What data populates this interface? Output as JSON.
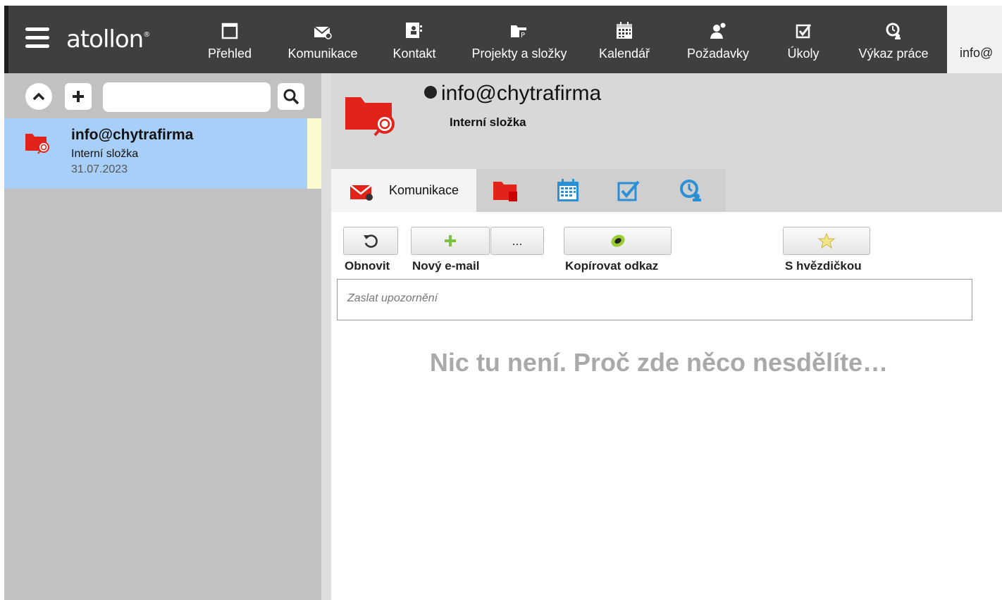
{
  "app": {
    "logo_text": "atollon",
    "logo_mark": "®"
  },
  "nav": {
    "items": [
      {
        "label": "Přehled",
        "icon": "window-icon"
      },
      {
        "label": "Komunikace",
        "icon": "mail-icon"
      },
      {
        "label": "Kontakt",
        "icon": "contact-card-icon"
      },
      {
        "label": "Projekty a složky",
        "icon": "project-folder-icon"
      },
      {
        "label": "Kalendář",
        "icon": "calendar-icon"
      },
      {
        "label": "Požadavky",
        "icon": "request-user-icon"
      },
      {
        "label": "Úkoly",
        "icon": "checkbox-icon"
      },
      {
        "label": "Výkaz práce",
        "icon": "time-tracking-icon"
      }
    ],
    "active_tab_label": "info@"
  },
  "sidebar": {
    "collapse_icon": "chevron-up-icon",
    "add_icon": "plus-icon",
    "search_value": "",
    "search_icon": "search-icon",
    "items": [
      {
        "title": "info@chytrafirma",
        "subtitle": "Interní složka",
        "date": "31.07.2023",
        "icon": "folder-search-icon"
      }
    ]
  },
  "header": {
    "title": "info@chytrafirma",
    "subtitle": "Interní složka"
  },
  "tabs": [
    {
      "label": "Komunikace",
      "icon": "mail-icon",
      "active": true
    },
    {
      "label": "",
      "icon": "folder-icon"
    },
    {
      "label": "",
      "icon": "calendar-icon"
    },
    {
      "label": "",
      "icon": "checkbox-icon"
    },
    {
      "label": "",
      "icon": "time-tracking-icon"
    }
  ],
  "toolbar": {
    "refresh_label": "Obnovit",
    "new_email_label": "Nový e-mail",
    "more_symbol": "...",
    "copy_link_label": "Kopírovat odkaz",
    "starred_label": "S hvězdičkou"
  },
  "notify": {
    "placeholder": "Zaslat upozornění"
  },
  "empty_message": "Nic tu není. Proč zde něco nesdělíte…",
  "colors": {
    "nav_bg": "#3f3f3f",
    "sidebar_bg": "#c1c1c1",
    "selected_row": "#a8cff8",
    "brand_red": "#e2231a",
    "calendar_blue": "#2b8fd6",
    "link_green": "#9acd32"
  }
}
